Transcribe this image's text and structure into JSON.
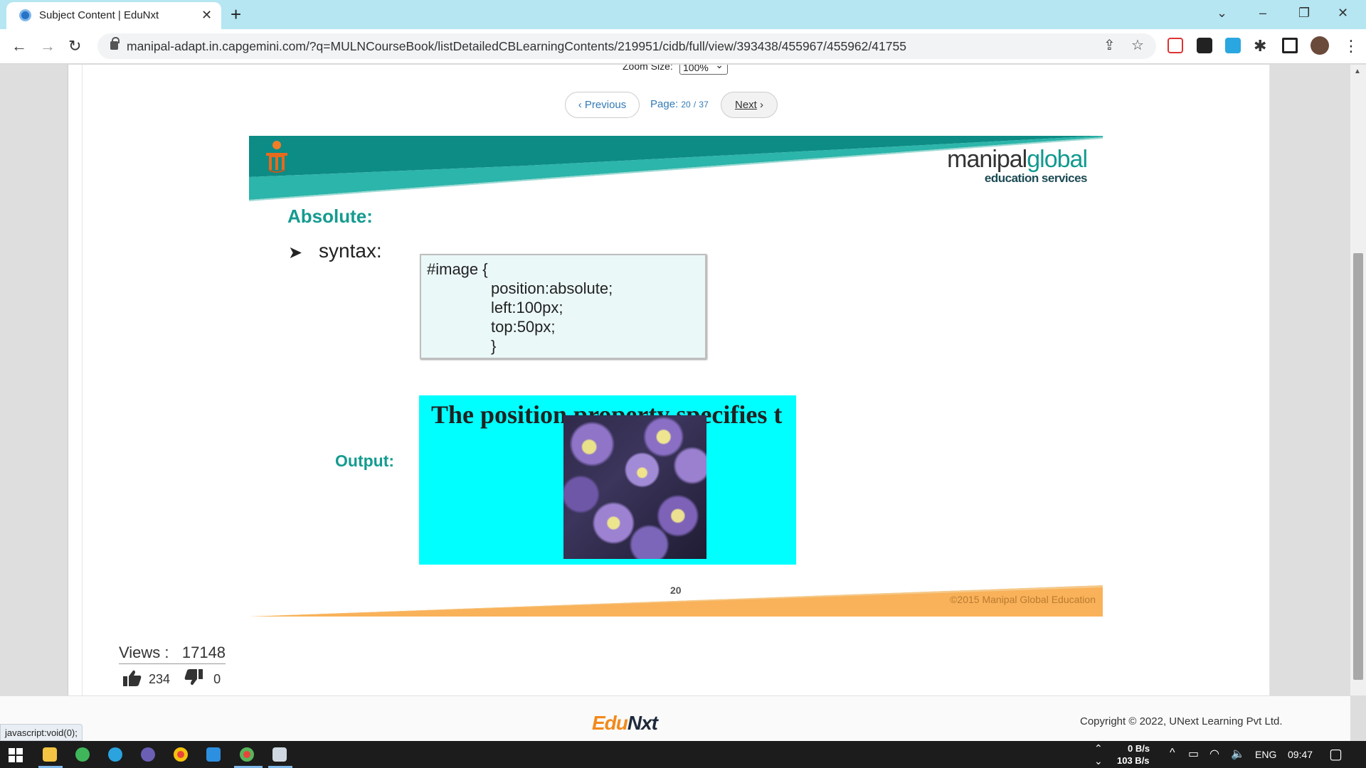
{
  "browser": {
    "tab_title": "Subject Content | EduNxt",
    "url": "manipal-adapt.in.capgemini.com/?q=MULNCourseBook/listDetailedCBLearningContents/219951/cidb/full/view/393438/455967/455962/41755"
  },
  "viewer": {
    "zoom_label": "Zoom Size:",
    "zoom_value": "100%",
    "prev_label": "Previous",
    "next_label": "Next",
    "page_label": "Page:",
    "page_current": "20",
    "page_sep": "/",
    "page_total": "37"
  },
  "slide": {
    "brand_name_a": "manipal",
    "brand_name_b": "global",
    "brand_sub": "education services",
    "title": "Absolute:",
    "bullet": "syntax:",
    "code": {
      "line1": "#image {",
      "line2": "position:absolute;",
      "line3": "left:100px;",
      "line4": "top:50px;",
      "line5": "}"
    },
    "output_label": "Output:",
    "output_text": "The position property specifies t",
    "page_number": "20",
    "copyright": "©2015 Manipal Global Education"
  },
  "stats": {
    "views_label": "Views :",
    "views_count": "17148",
    "likes": "234",
    "dislikes": "0"
  },
  "footer": {
    "logo_a": "Edu",
    "logo_b": "Nxt",
    "copyright": "Copyright © 2022, UNext Learning Pvt Ltd.",
    "status_url": "javascript:void(0);"
  },
  "taskbar": {
    "net_up": "0 B/s",
    "net_down": "103 B/s",
    "lang": "ENG",
    "time": "09:47"
  },
  "colors": {
    "teal": "#159b90",
    "orange_band": "#f9b25a",
    "cyan_box": "#00ffff"
  }
}
